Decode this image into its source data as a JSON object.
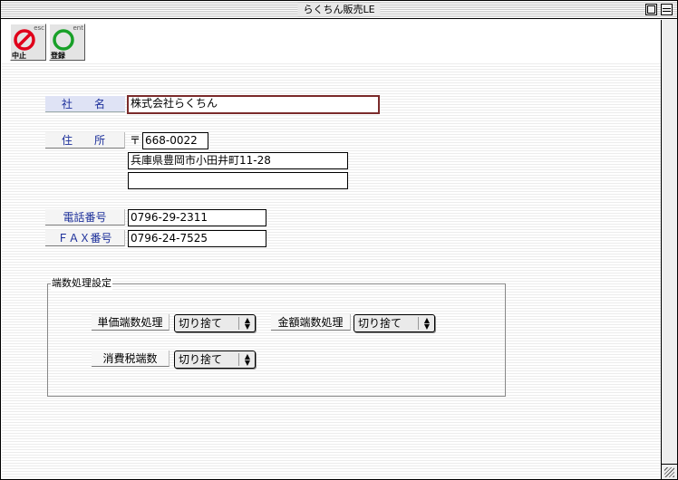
{
  "window": {
    "title": "らくちん販売LE"
  },
  "toolbar": {
    "cancel": {
      "key": "esc",
      "label": "中止",
      "color": "#e0001a"
    },
    "register": {
      "key": "ent",
      "label": "登録",
      "color": "#18a028"
    }
  },
  "company": {
    "label": "社　　名",
    "value": "株式会社らくちん"
  },
  "address": {
    "label": "住　　所",
    "postal_mark": "〒",
    "postal_code": "668-0022",
    "line1": "兵庫県豊岡市小田井町11-28",
    "line2": ""
  },
  "phone": {
    "label": "電話番号",
    "value": "0796-29-2311"
  },
  "fax": {
    "label": "ＦＡＸ番号",
    "value": "0796-24-7525"
  },
  "rounding": {
    "group_title": "端数処理設定",
    "unit_price": {
      "label": "単価端数処理",
      "value": "切り捨て"
    },
    "amount": {
      "label": "金額端数処理",
      "value": "切り捨て"
    },
    "tax": {
      "label": "消費税端数",
      "value": "切り捨て"
    }
  }
}
